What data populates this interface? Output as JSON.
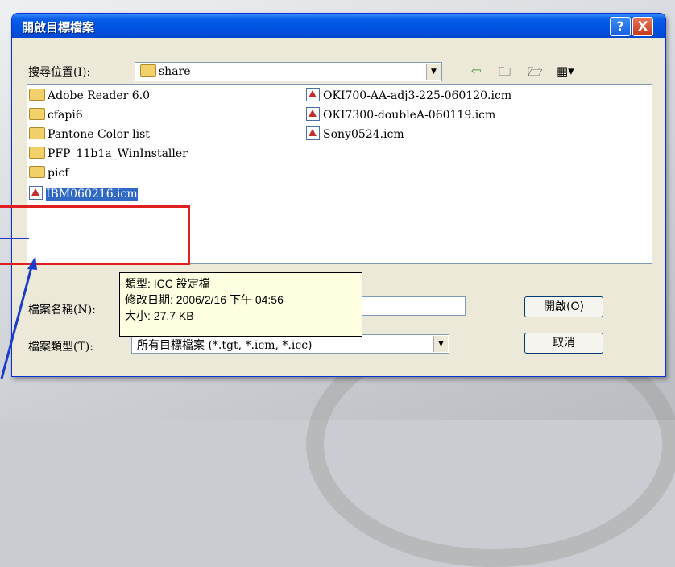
{
  "dialog": {
    "title": "開啟目標檔案",
    "help_label": "?",
    "close_label": "X"
  },
  "location": {
    "label": "搜尋位置(I):",
    "value": "share"
  },
  "files": [
    {
      "name": "Adobe Reader 6.0",
      "type": "folder"
    },
    {
      "name": "cfapi6",
      "type": "folder"
    },
    {
      "name": "Pantone Color list",
      "type": "folder"
    },
    {
      "name": "PFP_11b1a_WinInstaller",
      "type": "folder"
    },
    {
      "name": "picf",
      "type": "folder"
    },
    {
      "name": "IBM060216.icm",
      "type": "icm",
      "selected": true
    },
    {
      "name": "OKI700-AA-adj3-225-060120.icm",
      "type": "icm"
    },
    {
      "name": "OKI7300-doubleA-060119.icm",
      "type": "icm"
    },
    {
      "name": "Sony0524.icm",
      "type": "icm"
    }
  ],
  "filename": {
    "label": "檔案名稱(N):",
    "value": ""
  },
  "filetype": {
    "label": "檔案類型(T):",
    "value": "所有目標檔案 (*.tgt, *.icm, *.icc)"
  },
  "buttons": {
    "open": "開啟(O)",
    "cancel": "取消"
  },
  "tooltip": {
    "type": "類型: ICC 設定檔",
    "modified": "修改日期: 2006/2/16 下午 04:56",
    "size": "大小: 27.7 KB"
  },
  "colors": {
    "title_bar": "#0054e3",
    "selection": "#316ac5",
    "highlight_box": "#e02020"
  }
}
